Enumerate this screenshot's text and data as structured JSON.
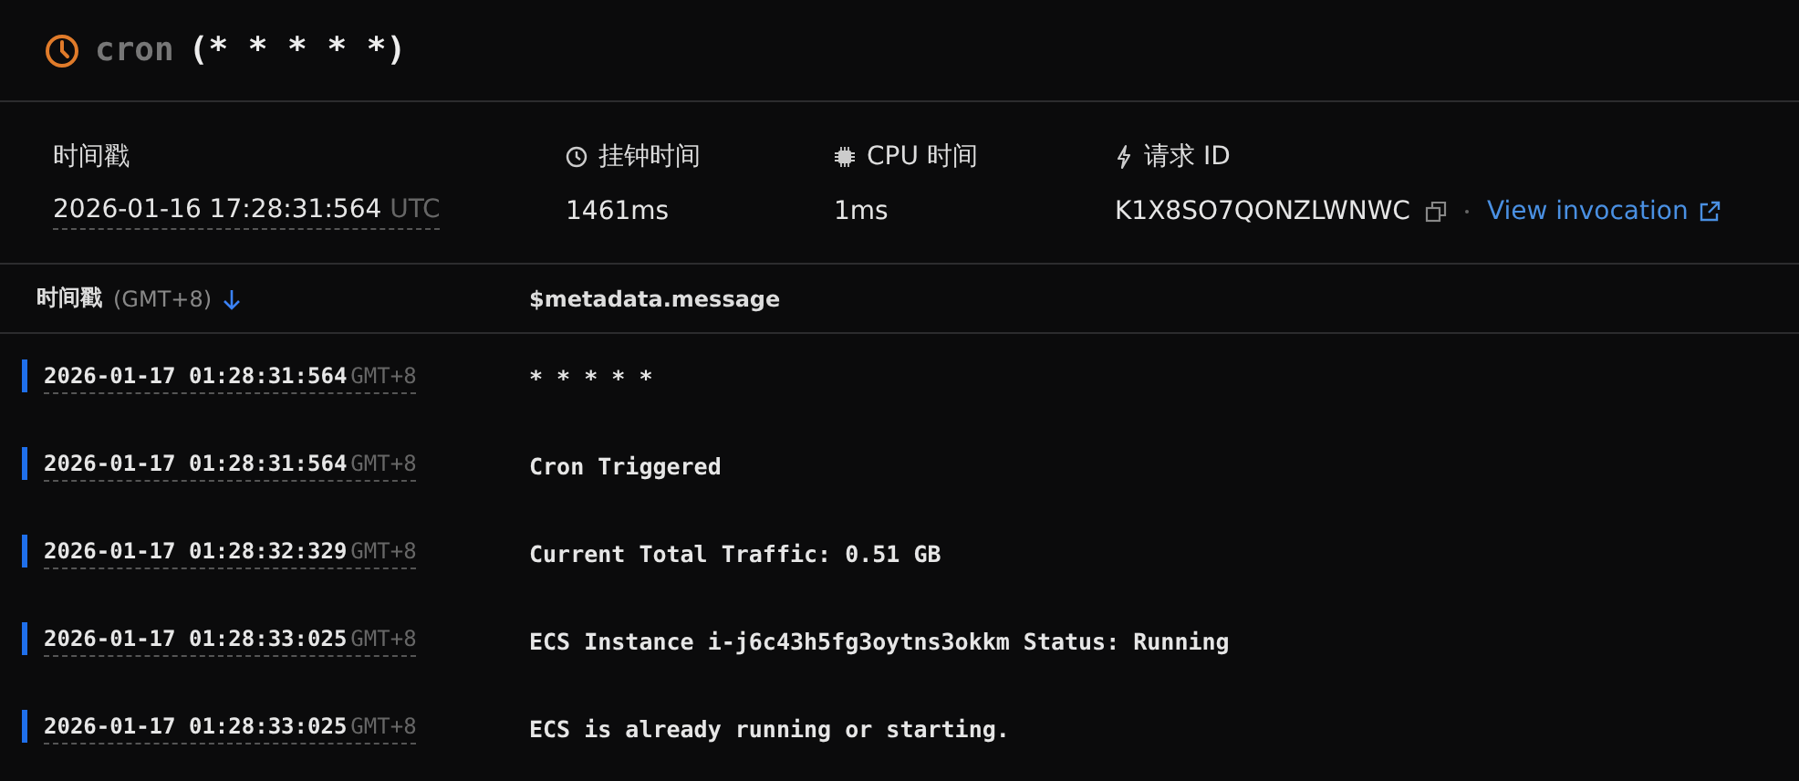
{
  "header": {
    "title": "cron",
    "schedule": "(* * * * *)"
  },
  "meta": [
    {
      "kind": "timestamp",
      "label": "时间戳",
      "value": "2026-01-16 17:28:31:564",
      "suffix": "UTC"
    },
    {
      "kind": "wall",
      "label": "挂钟时间",
      "value": "1461ms"
    },
    {
      "kind": "cpu",
      "label": "CPU 时间",
      "value": "1ms"
    },
    {
      "kind": "request",
      "label": "请求 ID",
      "value": "K1X8SO7QONZLWNWC",
      "link": "View invocation"
    }
  ],
  "table": {
    "columns": [
      {
        "label": "时间戳",
        "note": "(GMT+8)",
        "sorted": true
      },
      {
        "label": "$metadata.message"
      }
    ],
    "rows": [
      {
        "time": "2026-01-17 01:28:31:564",
        "zone": "GMT+8",
        "message": "* * * * *"
      },
      {
        "time": "2026-01-17 01:28:31:564",
        "zone": "GMT+8",
        "message": "Cron Triggered"
      },
      {
        "time": "2026-01-17 01:28:32:329",
        "zone": "GMT+8",
        "message": "Current Total Traffic: 0.51 GB"
      },
      {
        "time": "2026-01-17 01:28:33:025",
        "zone": "GMT+8",
        "message": "ECS Instance i-j6c43h5fg3oytns3okkm Status: Running"
      },
      {
        "time": "2026-01-17 01:28:33:025",
        "zone": "GMT+8",
        "message": "ECS is already running or starting."
      }
    ]
  }
}
